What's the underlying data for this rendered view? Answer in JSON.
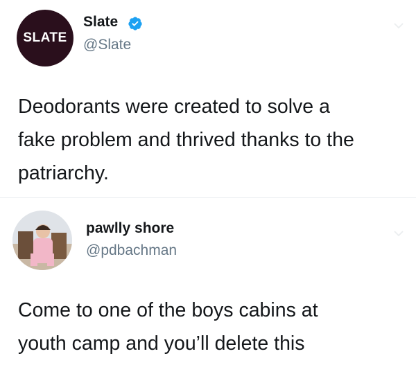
{
  "tweets": [
    {
      "display_name": "Slate",
      "handle": "@Slate",
      "avatar_icon": "slate-logo-avatar",
      "avatar_text": "SLATE",
      "avatar_color": "#2a0f1c",
      "verified": true,
      "verified_color": "#1da1f2",
      "lines": [
        "Deodorants were created to solve a",
        "fake problem and thrived thanks to the",
        "patriarchy."
      ]
    },
    {
      "display_name": "pawlly shore",
      "handle": "@pdbachman",
      "avatar_icon": "person-photo-avatar",
      "verified": false,
      "lines": [
        "Come to one of the boys cabins at",
        "youth camp and you’ll delete this"
      ]
    }
  ],
  "colors": {
    "text": "#14171a",
    "handle": "#657786"
  },
  "icons": [
    "verified-badge-icon",
    "chevron-down-icon"
  ]
}
